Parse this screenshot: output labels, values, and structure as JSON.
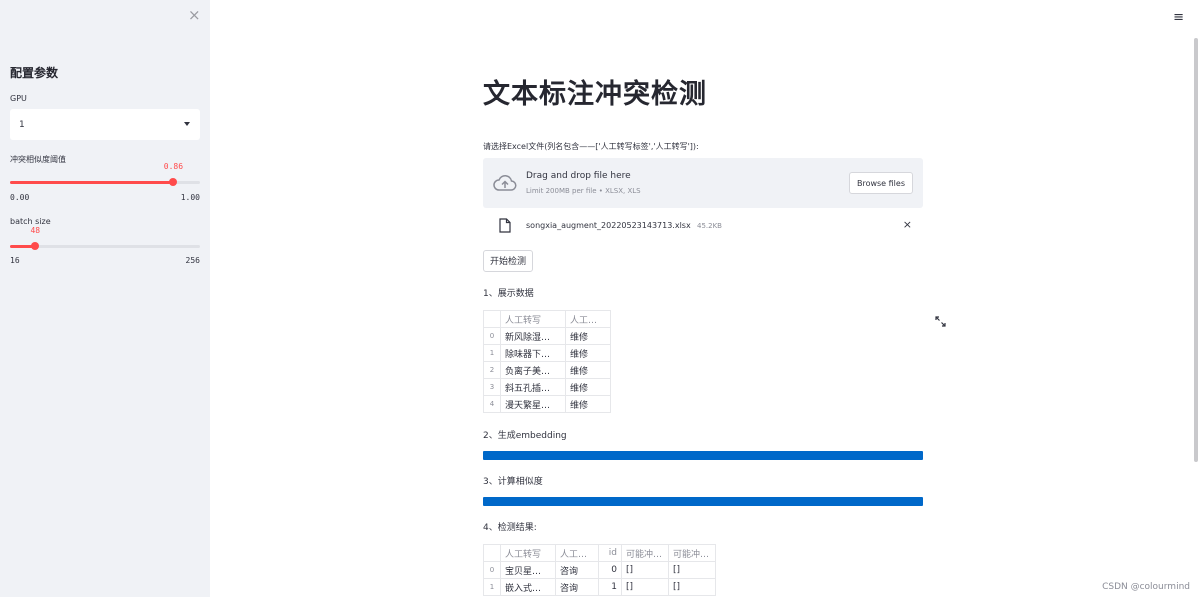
{
  "sidebar": {
    "close_icon": "×",
    "title": "配置参数",
    "gpu": {
      "label": "GPU",
      "value": "1"
    },
    "threshold": {
      "label": "冲突相似度阈值",
      "value": "0.86",
      "min": "0.00",
      "max": "1.00",
      "fraction": 0.86
    },
    "batch": {
      "label": "batch size",
      "value": "48",
      "min": "16",
      "max": "256",
      "fraction": 0.1333
    }
  },
  "header": {
    "menu_icon": "≡"
  },
  "main": {
    "title": "文本标注冲突检测",
    "upload_label": "请选择Excel文件(列名包含——['人工转写标签','人工转写']):",
    "dropzone": {
      "main": "Drag and drop file here",
      "sub": "Limit 200MB per file • XLSX, XLS",
      "browse": "Browse files"
    },
    "file": {
      "name": "songxia_augment_20220523143713.xlsx",
      "size": "45.2KB",
      "remove": "×"
    },
    "start_button": "开始检测",
    "section1": "1、展示数据",
    "table1": {
      "columns": [
        "",
        "人工转写",
        "人工…"
      ],
      "rows": [
        [
          "0",
          "新风除湿…",
          "维修"
        ],
        [
          "1",
          "除味器下…",
          "维修"
        ],
        [
          "2",
          "负离子美…",
          "维修"
        ],
        [
          "3",
          "斜五孔插…",
          "维修"
        ],
        [
          "4",
          "漫天繁星…",
          "维修"
        ]
      ]
    },
    "section2": "2、生成embedding",
    "progress_embedding": 1.0,
    "section3": "3、计算相似度",
    "progress_similarity": 1.0,
    "section4": "4、检测结果:",
    "table2": {
      "columns": [
        "",
        "人工转写",
        "人工…",
        "id",
        "可能冲…",
        "可能冲…"
      ],
      "rows": [
        [
          "0",
          "宝贝星…",
          "咨询",
          "0",
          "[]",
          "[]"
        ],
        [
          "1",
          "嵌入式…",
          "咨询",
          "1",
          "[]",
          "[]"
        ]
      ]
    }
  },
  "watermark": "CSDN @colourmind",
  "colors": {
    "accent": "#ff4b4b",
    "progress": "#0068c9",
    "sidebar_bg": "#f0f2f6"
  }
}
